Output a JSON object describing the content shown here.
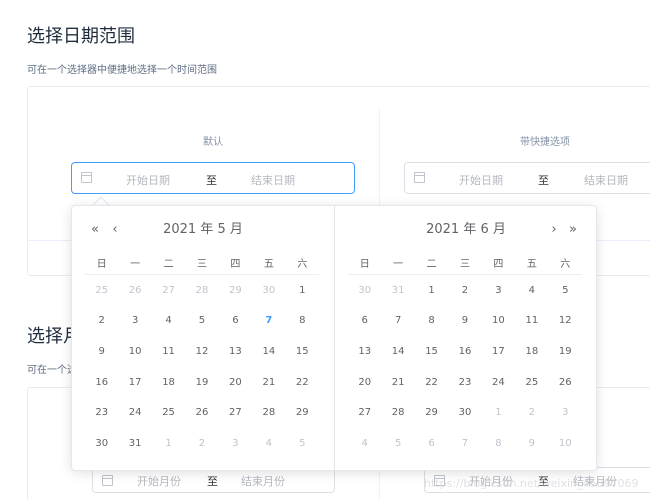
{
  "section1": {
    "title": "选择日期范围",
    "desc": "可在一个选择器中便捷地选择一个时间范围"
  },
  "section2": {
    "title": "选择月份范围",
    "desc": "可在一个选择器中便捷地选择一个月份范围"
  },
  "blocks": {
    "default": {
      "label": "默认",
      "start_placeholder": "开始日期",
      "separator": "至",
      "end_placeholder": "结束日期"
    },
    "shortcuts": {
      "label": "带快捷选项",
      "start_placeholder": "开始日期",
      "separator": "至",
      "end_placeholder": "结束日期"
    },
    "month_default": {
      "start_placeholder": "开始月份",
      "separator": "至",
      "end_placeholder": "结束月份"
    },
    "month_shortcuts": {
      "start_placeholder": "开始月份",
      "separator": "至",
      "end_placeholder": "结束月份"
    }
  },
  "picker": {
    "weekdays": [
      "日",
      "一",
      "二",
      "三",
      "四",
      "五",
      "六"
    ],
    "left": {
      "title": "2021 年 5 月",
      "days": [
        {
          "d": "25",
          "o": true
        },
        {
          "d": "26",
          "o": true
        },
        {
          "d": "27",
          "o": true
        },
        {
          "d": "28",
          "o": true
        },
        {
          "d": "29",
          "o": true
        },
        {
          "d": "30",
          "o": true
        },
        {
          "d": "1"
        },
        {
          "d": "2"
        },
        {
          "d": "3"
        },
        {
          "d": "4"
        },
        {
          "d": "5"
        },
        {
          "d": "6"
        },
        {
          "d": "7",
          "today": true
        },
        {
          "d": "8"
        },
        {
          "d": "9"
        },
        {
          "d": "10"
        },
        {
          "d": "11"
        },
        {
          "d": "12"
        },
        {
          "d": "13"
        },
        {
          "d": "14"
        },
        {
          "d": "15"
        },
        {
          "d": "16"
        },
        {
          "d": "17"
        },
        {
          "d": "18"
        },
        {
          "d": "19"
        },
        {
          "d": "20"
        },
        {
          "d": "21"
        },
        {
          "d": "22"
        },
        {
          "d": "23"
        },
        {
          "d": "24"
        },
        {
          "d": "25"
        },
        {
          "d": "26"
        },
        {
          "d": "27"
        },
        {
          "d": "28"
        },
        {
          "d": "29"
        },
        {
          "d": "30"
        },
        {
          "d": "31"
        },
        {
          "d": "1",
          "o": true
        },
        {
          "d": "2",
          "o": true
        },
        {
          "d": "3",
          "o": true
        },
        {
          "d": "4",
          "o": true
        },
        {
          "d": "5",
          "o": true
        }
      ]
    },
    "right": {
      "title": "2021 年 6 月",
      "days": [
        {
          "d": "30",
          "o": true
        },
        {
          "d": "31",
          "o": true
        },
        {
          "d": "1"
        },
        {
          "d": "2"
        },
        {
          "d": "3"
        },
        {
          "d": "4"
        },
        {
          "d": "5"
        },
        {
          "d": "6"
        },
        {
          "d": "7"
        },
        {
          "d": "8"
        },
        {
          "d": "9"
        },
        {
          "d": "10"
        },
        {
          "d": "11"
        },
        {
          "d": "12"
        },
        {
          "d": "13"
        },
        {
          "d": "14"
        },
        {
          "d": "15"
        },
        {
          "d": "16"
        },
        {
          "d": "17"
        },
        {
          "d": "18"
        },
        {
          "d": "19"
        },
        {
          "d": "20"
        },
        {
          "d": "21"
        },
        {
          "d": "22"
        },
        {
          "d": "23"
        },
        {
          "d": "24"
        },
        {
          "d": "25"
        },
        {
          "d": "26"
        },
        {
          "d": "27"
        },
        {
          "d": "28"
        },
        {
          "d": "29"
        },
        {
          "d": "30"
        },
        {
          "d": "1",
          "o": true
        },
        {
          "d": "2",
          "o": true
        },
        {
          "d": "3",
          "o": true
        },
        {
          "d": "4",
          "o": true
        },
        {
          "d": "5",
          "o": true
        },
        {
          "d": "6",
          "o": true
        },
        {
          "d": "7",
          "o": true
        },
        {
          "d": "8",
          "o": true
        },
        {
          "d": "9",
          "o": true
        },
        {
          "d": "10",
          "o": true
        }
      ]
    },
    "nav": {
      "prev_year": "«",
      "prev_month": "‹",
      "next_month": "›",
      "next_year": "»"
    }
  },
  "watermark": "https://blog.csdn.net/weixin_45097069",
  "colors": {
    "accent": "#409eff",
    "muted": "#c0c4cc",
    "text": "#606266"
  }
}
